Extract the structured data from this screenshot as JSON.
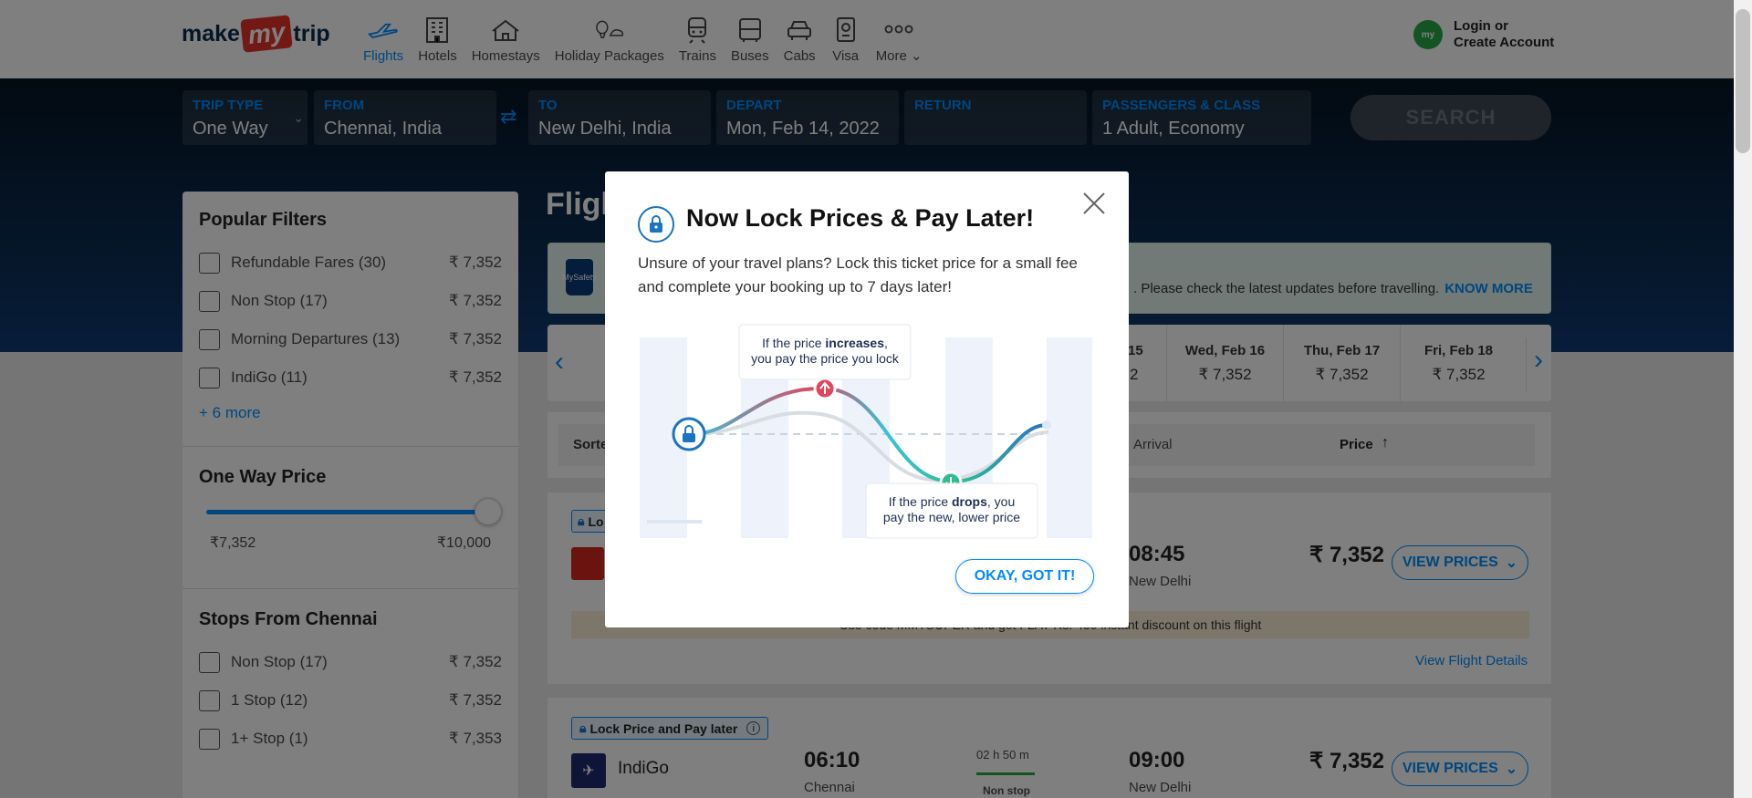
{
  "header": {
    "logo": {
      "make": "make",
      "my": "my",
      "trip": "trip"
    },
    "nav": [
      {
        "label": "Flights",
        "icon": "plane-icon"
      },
      {
        "label": "Hotels",
        "icon": "hotel-icon"
      },
      {
        "label": "Homestays",
        "icon": "homestay-icon"
      },
      {
        "label": "Holiday Packages",
        "icon": "holiday-icon"
      },
      {
        "label": "Trains",
        "icon": "train-icon"
      },
      {
        "label": "Buses",
        "icon": "bus-icon"
      },
      {
        "label": "Cabs",
        "icon": "cab-icon"
      },
      {
        "label": "Visa",
        "icon": "visa-icon"
      },
      {
        "label": "More",
        "icon": "more-icon"
      }
    ],
    "account": {
      "avatar": "my",
      "line1": "Login or",
      "line2": "Create Account"
    }
  },
  "search": {
    "trip_type": {
      "label": "TRIP TYPE",
      "value": "One Way"
    },
    "from": {
      "label": "FROM",
      "value": "Chennai, India"
    },
    "to": {
      "label": "TO",
      "value": "New Delhi, India"
    },
    "depart": {
      "label": "DEPART",
      "value": "Mon, Feb 14, 2022"
    },
    "return": {
      "label": "RETURN",
      "value": ""
    },
    "pax": {
      "label": "PASSENGERS & CLASS",
      "value": "1 Adult, Economy"
    },
    "button": "SEARCH"
  },
  "filters": {
    "popular_title": "Popular Filters",
    "popular": [
      {
        "label": "Refundable Fares (30)",
        "price": "₹ 7,352"
      },
      {
        "label": "Non Stop (17)",
        "price": "₹ 7,352"
      },
      {
        "label": "Morning Departures (13)",
        "price": "₹ 7,352"
      },
      {
        "label": "IndiGo (11)",
        "price": "₹ 7,352"
      }
    ],
    "more": "+ 6 more",
    "price_title": "One Way Price",
    "price_min": "₹7,352",
    "price_max": "₹10,000",
    "price_slider_value": 1.0,
    "stops_title": "Stops From Chennai",
    "stops": [
      {
        "label": "Non Stop (17)",
        "price": "₹ 7,352"
      },
      {
        "label": "1 Stop (12)",
        "price": "₹ 7,352"
      },
      {
        "label": "1+ Stop (1)",
        "price": "₹ 7,353"
      }
    ]
  },
  "main": {
    "title": "Fligh",
    "safety_text": ". Please check the latest updates before travelling.",
    "safety_link": "KNOW MORE",
    "safety_badge": "MySafety",
    "dates": [
      {
        "day": "15",
        "price": "2"
      },
      {
        "day": "Wed, Feb 16",
        "price": "₹ 7,352"
      },
      {
        "day": "Thu, Feb 17",
        "price": "₹ 7,352"
      },
      {
        "day": "Fri, Feb 18",
        "price": "₹ 7,352"
      }
    ],
    "sort": {
      "label": "Sorte",
      "arrival": "Arrival",
      "price": "Price",
      "arrow": "↑"
    },
    "flight1": {
      "lock": "Lo",
      "arrive_time": "08:45",
      "arrive_city": "New Delhi",
      "price": "₹ 7,352",
      "view_prices": "VIEW PRICES",
      "offer": "Use code MMTSUPER and get FLAT Rs. 450 instant discount on this flight",
      "details": "View Flight Details"
    },
    "flight2": {
      "lock": "Lock Price and Pay later",
      "airline": "IndiGo",
      "depart_time": "06:10",
      "depart_city": "Chennai",
      "duration": "02 h 50 m",
      "stops": "Non stop",
      "arrive_time": "09:00",
      "arrive_city": "New Delhi",
      "price": "₹ 7,352",
      "view_prices": "VIEW PRICES"
    }
  },
  "modal": {
    "title": "Now Lock Prices & Pay Later!",
    "body": "Unsure of your travel plans? Lock this ticket price for a small fee and complete your booking up to 7 days later!",
    "increase_pre": "If the price ",
    "increase_bold": "increases",
    "increase_post": ",",
    "increase_line2": "you pay the price you lock",
    "drop_pre": "If the price ",
    "drop_bold": "drops",
    "drop_post": ", you",
    "drop_line2": "pay the new, lower price",
    "ok": "OKAY, GOT IT!"
  }
}
